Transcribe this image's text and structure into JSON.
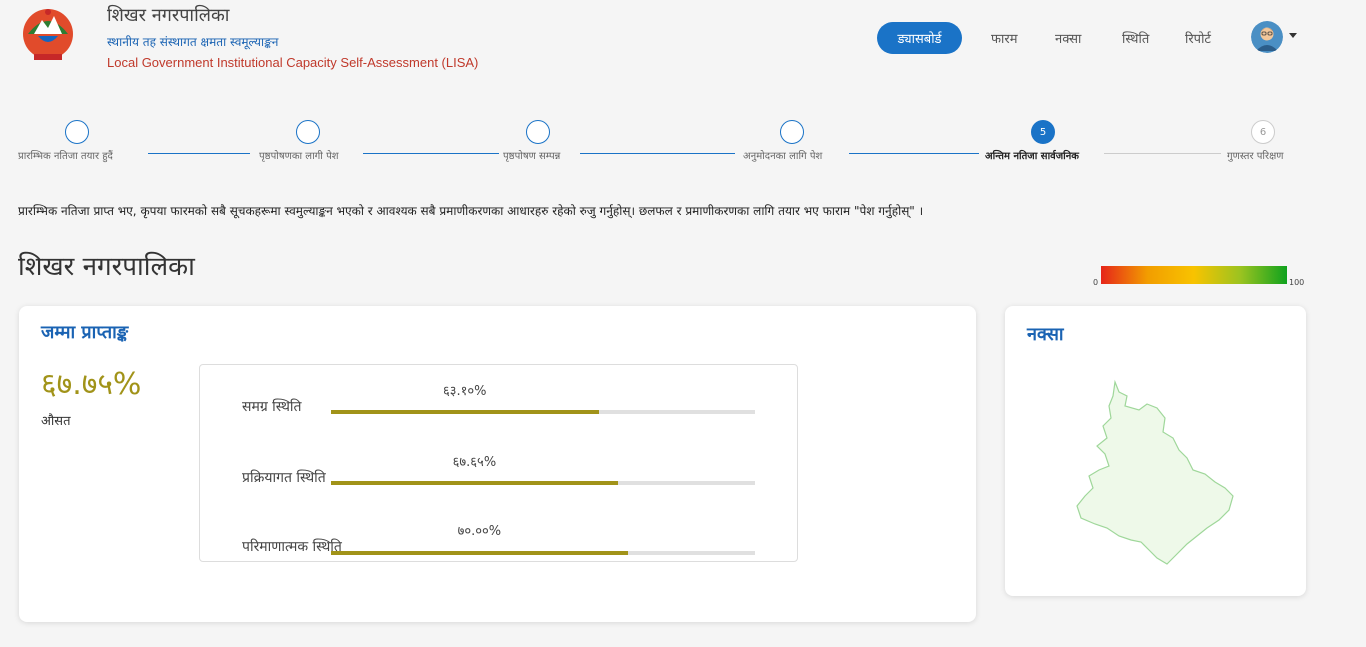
{
  "header": {
    "title": "शिखर नगरपालिका",
    "subtitle_np": "स्थानीय तह संस्थागत क्षमता स्वमूल्याङ्कन",
    "subtitle_en": "Local Government Institutional Capacity Self-Assessment (LISA)"
  },
  "nav": {
    "dashboard": "ड्यासबोर्ड",
    "form": "फारम",
    "map": "नक्सा",
    "status": "स्थिति",
    "report": "रिपोर्ट"
  },
  "stepper": {
    "steps": [
      {
        "label": "प्रारम्भिक नतिजा तयार हुदैं",
        "number": "",
        "state": "done"
      },
      {
        "label": "पृष्ठपोषणका लागी पेश",
        "number": "",
        "state": "done"
      },
      {
        "label": "पृष्ठपोषण सम्पन्न",
        "number": "",
        "state": "done"
      },
      {
        "label": "अनुमोदनका लागि पेश",
        "number": "",
        "state": "done"
      },
      {
        "label": "अन्तिम नतिजा सार्वजनिक",
        "number": "5",
        "state": "active"
      },
      {
        "label": "गुणस्तर परिक्षण",
        "number": "6",
        "state": "disabled"
      }
    ]
  },
  "instruction": "प्रारम्भिक नतिजा प्राप्त भए, कृपया फारमको सबै सूचकहरूमा स्वमुल्याङ्कन भएको र आवश्यक सबै प्रमाणीकरणका आधारहरु रहेको रुजु गर्नुहोस्। छलफल र प्रमाणीकरणका लागि तयार भए फाराम \"पेश गर्नुहोस्\" ।",
  "municipality": "शिखर नगरपालिका",
  "legend": {
    "min": "0",
    "max": "100"
  },
  "score_card": {
    "heading": "जम्मा प्राप्ताङ्क",
    "total": "६७.७५%",
    "total_label": "औसत",
    "metrics": [
      {
        "label": "समग्र स्थिति",
        "value_text": "६३.१०%",
        "value": 63.1
      },
      {
        "label": "प्रक्रियागत स्थिति",
        "value_text": "६७.६५%",
        "value": 67.65
      },
      {
        "label": "परिमाणात्मक स्थिति",
        "value_text": "७०.००%",
        "value": 70.0
      }
    ]
  },
  "map_card": {
    "heading": "नक्सा"
  },
  "colors": {
    "primary": "#1a73c7",
    "score": "#a19319",
    "map_fill": "#eef9e9",
    "map_stroke": "#9fd79a"
  }
}
